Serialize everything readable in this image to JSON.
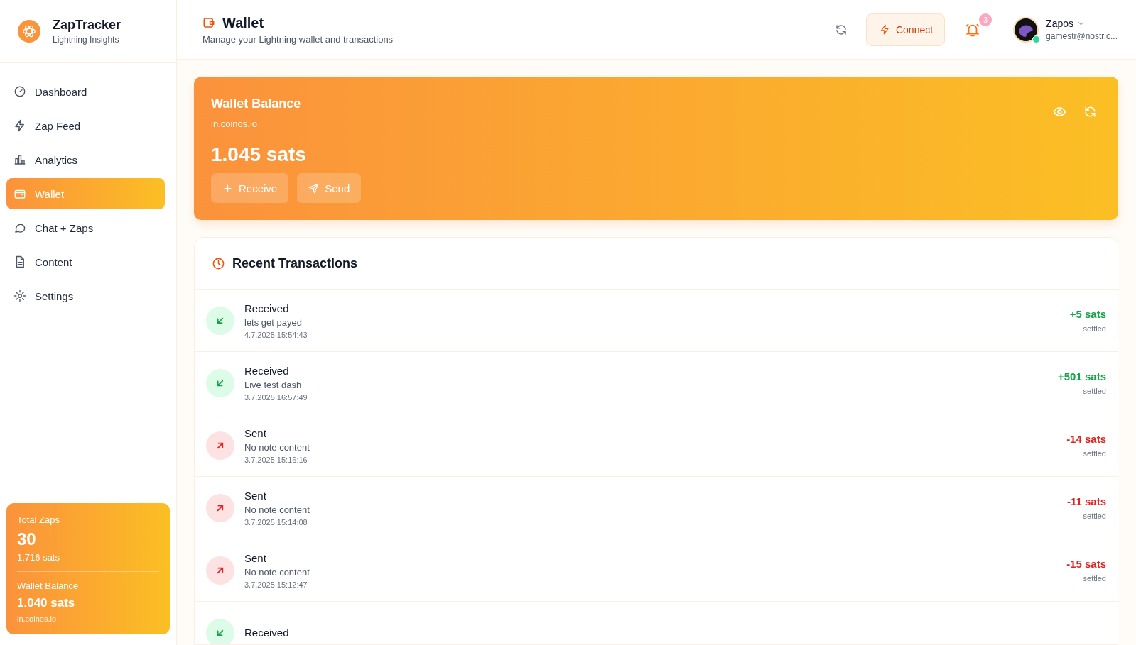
{
  "brand": {
    "name": "ZapTracker",
    "tagline": "Lightning Insights"
  },
  "nav": [
    {
      "label": "Dashboard",
      "selected": false
    },
    {
      "label": "Zap Feed",
      "selected": false
    },
    {
      "label": "Analytics",
      "selected": false
    },
    {
      "label": "Wallet",
      "selected": true
    },
    {
      "label": "Chat + Zaps",
      "selected": false
    },
    {
      "label": "Content",
      "selected": false
    },
    {
      "label": "Settings",
      "selected": false
    }
  ],
  "sidebar_stats": {
    "zaps_label": "Total Zaps",
    "zaps_count": "30",
    "zaps_sats": "1.716 sats",
    "balance_label": "Wallet Balance",
    "balance": "1.040 sats",
    "provider": "ln.coinos.io"
  },
  "header": {
    "title": "Wallet",
    "subtitle": "Manage your Lightning wallet and transactions",
    "connect": "Connect",
    "notifications": "3",
    "user": {
      "name": "Zapos",
      "email": "gamestr@nostr.c...",
      "online": true
    }
  },
  "balance_card": {
    "title": "Wallet Balance",
    "provider": "ln.coinos.io",
    "amount": "1.045 sats",
    "buttons": [
      "Receive",
      "Send"
    ]
  },
  "transactions": {
    "title": "Recent Transactions",
    "rows": [
      {
        "kind": "received",
        "title": "Received",
        "note": "lets get payed",
        "date": "4.7.2025 15:54:43",
        "amount": "+5 sats",
        "status": "settled"
      },
      {
        "kind": "received",
        "title": "Received",
        "note": "Live test dash",
        "date": "3.7.2025 16:57:49",
        "amount": "+501 sats",
        "status": "settled"
      },
      {
        "kind": "sent",
        "title": "Sent",
        "note": "No note content",
        "date": "3.7.2025 15:16:16",
        "amount": "-14 sats",
        "status": "settled"
      },
      {
        "kind": "sent",
        "title": "Sent",
        "note": "No note content",
        "date": "3.7.2025 15:14:08",
        "amount": "-11 sats",
        "status": "settled"
      },
      {
        "kind": "sent",
        "title": "Sent",
        "note": "No note content",
        "date": "3.7.2025 15:12:47",
        "amount": "-15 sats",
        "status": "settled"
      },
      {
        "kind": "received",
        "title": "Received"
      }
    ]
  }
}
